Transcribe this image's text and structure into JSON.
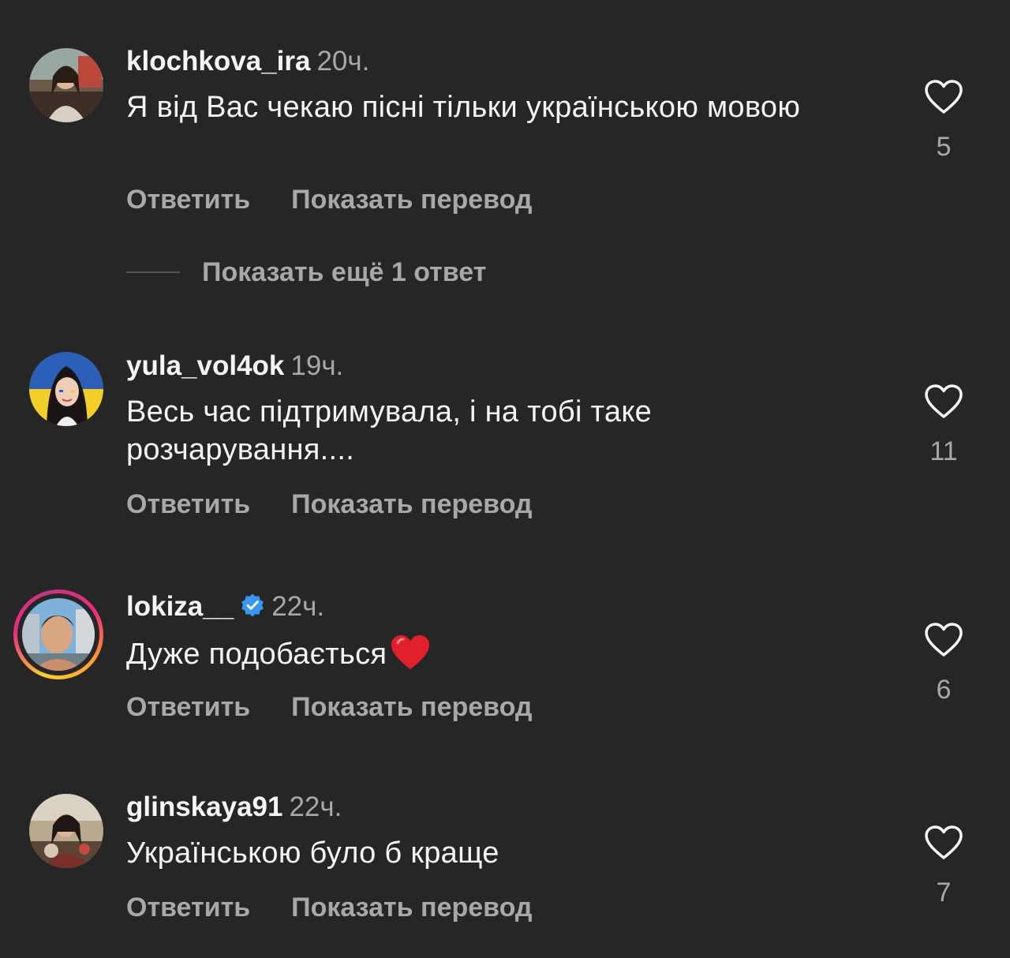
{
  "comments": [
    {
      "username": "klochkova_ira",
      "time": "20ч.",
      "text": "Я від Вас чекаю пісні тільки українською мовою",
      "reply_label": "Ответить",
      "translate_label": "Показать перевод",
      "likes": "5",
      "verified": false
    },
    {
      "username": "yula_vol4ok",
      "time": "19ч.",
      "text": "Весь час підтримувала, і на тобі таке розчарування....",
      "reply_label": "Ответить",
      "translate_label": "Показать перевод",
      "likes": "11",
      "verified": false
    },
    {
      "username": "lokiza__",
      "time": "22ч.",
      "text": "Дуже подобається",
      "reply_label": "Ответить",
      "translate_label": "Показать перевод",
      "likes": "6",
      "verified": true,
      "has_story_ring": true
    },
    {
      "username": "glinskaya91",
      "time": "22ч.",
      "text": "Українською було б краще",
      "reply_label": "Ответить",
      "translate_label": "Показать перевод",
      "likes": "7",
      "verified": false
    }
  ],
  "more_replies_label": "Показать ещё 1 ответ",
  "icons": {
    "like": "heart-outline-icon",
    "verified": "verified-badge-icon",
    "emoji": "red-heart-emoji"
  },
  "colors": {
    "background": "#262626",
    "primary_text": "#f5f5f5",
    "secondary_text": "#a8a8a8",
    "verified_blue": "#3897f0",
    "heart_red": "#e0202a"
  }
}
